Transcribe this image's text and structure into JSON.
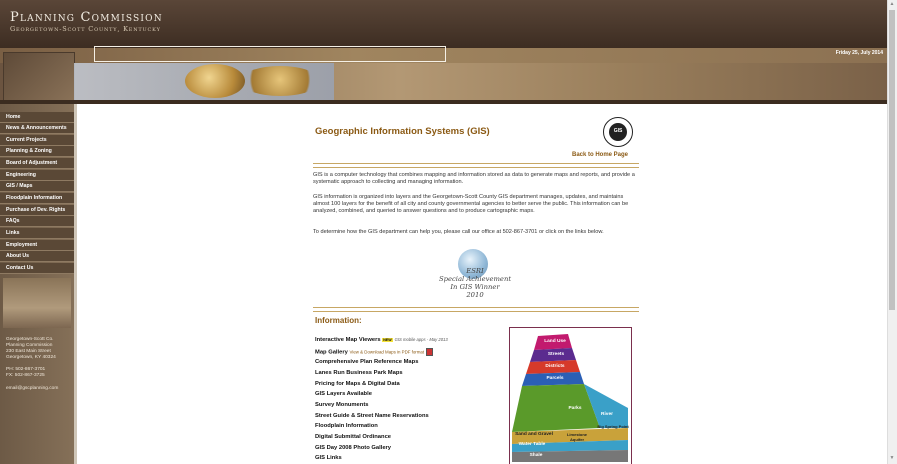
{
  "header": {
    "title": "Planning Commission",
    "subtitle": "Georgetown-Scott County, Kentucky",
    "date": "Friday 25, July 2014",
    "search_placeholder": ""
  },
  "nav": [
    "Home",
    "News & Announcements",
    "Current Projects",
    "Planning & Zoning",
    "Board of Adjustment",
    "Engineering",
    "GIS / Maps",
    "Floodplain Information",
    "Purchase of Dev. Rights",
    "FAQs",
    "Links",
    "Employment",
    "About Us",
    "Contact Us"
  ],
  "sidebar_contact": {
    "line1": "Georgetown-Scott Co.",
    "line2": "Planning Commission",
    "line3": "230 East Main Street",
    "line4": "Georgetown, KY 40324",
    "phone": "PH: 502-867-3701",
    "fax": "FX: 502-867-3725",
    "email": "email@gscplanning.com"
  },
  "content": {
    "title": "Geographic Information Systems (GIS)",
    "logo_text": "GIS",
    "back_link": "Back to Home Page",
    "para1": "GIS is a computer technology that combines mapping and information stored as data to generate maps and reports, and provide a systematic approach to collecting and managing information.",
    "para2": "GIS information is organized into layers and the Georgetown-Scott County GIS department manages, updates, and maintains almost 100 layers for the benefit of all city and county governmental agencies to better serve the public. This information can be analyzed, combined, and queried to answer questions and to produce cartographic maps.",
    "para3": "To determine how the GIS department can help you, please call our office at 502-867-3701 or click on the links below.",
    "award_line1": "ESRI",
    "award_line2": "Special Achievement",
    "award_line3": "In GIS Winner",
    "award_line4": "2010",
    "info_title": "Information:"
  },
  "links": {
    "l1": "Interactive Map Viewers",
    "l1_new": "NEW",
    "l1_note": "GIS mobile apps - May 2013",
    "l2": "Map Gallery",
    "l2_note": "View & Download Maps in PDF format",
    "l3": "Comprehensive Plan Reference Maps",
    "l4": "Lanes Run Business Park Maps",
    "l5": "Pricing for Maps & Digital Data",
    "l6": "GIS Layers Available",
    "l7": "Survey Monuments",
    "l8": "Street Guide & Street Name Reservations",
    "l9": "Floodplain Information",
    "l10": "Digital Submittal Ordinance",
    "l11": "GIS Day 2008 Photo Gallery",
    "l12": "GIS Links"
  },
  "pyramid": {
    "land_use": "Land Use",
    "streets": "Streets",
    "districts": "Districts",
    "parcels": "Parcels",
    "parks": "Parks",
    "river": "River",
    "sand": "Sand and Gravel",
    "limestone": "Limestone Aquifer",
    "water_table": "Water Table",
    "big_spring": "Big Spring Point",
    "shale": "Shale",
    "colors": {
      "land_use": "#c21a6e",
      "streets": "#5b2b8f",
      "districts": "#d63a2a",
      "parcels": "#2b5fb5",
      "parks": "#5a9a2a",
      "water": "#3aa0c8",
      "sand": "#c9a23a",
      "shale": "#777777"
    }
  }
}
